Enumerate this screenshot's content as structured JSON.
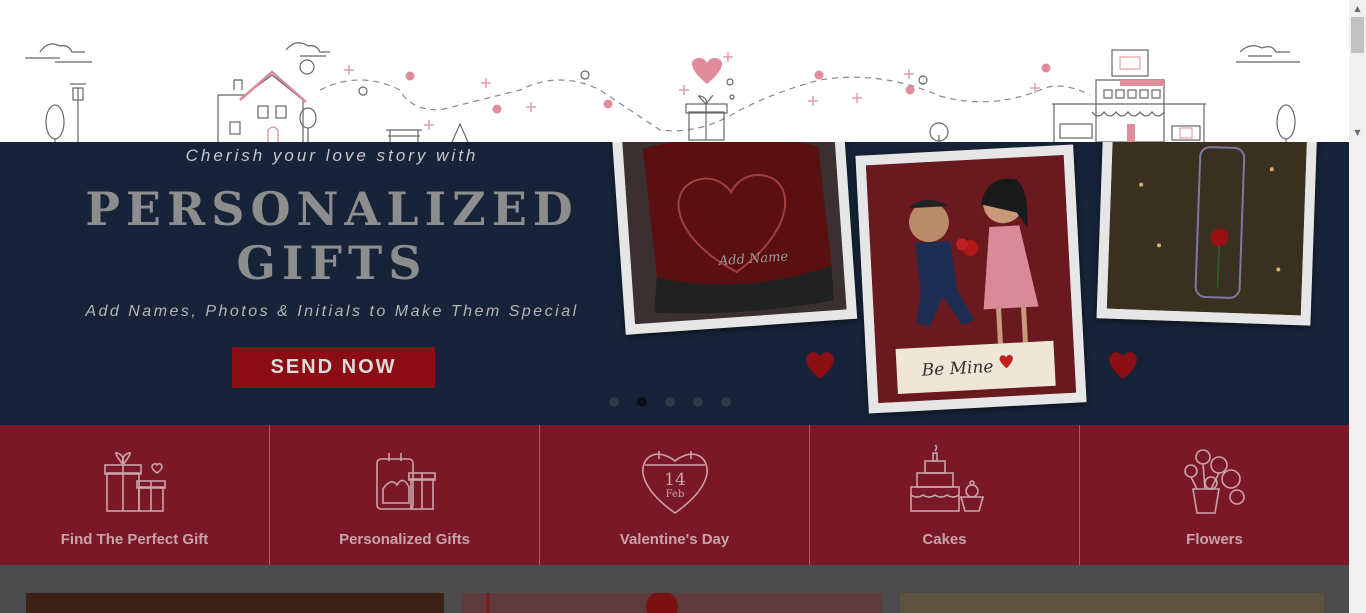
{
  "hero": {
    "tagline": "Cherish your love story with",
    "title_line1": "PERSONALIZED",
    "title_line2": "GIFTS",
    "subtitle": "Add Names, Photos & Initials to Make Them Special",
    "cta": "SEND NOW",
    "slides": 5,
    "active_slide": 2,
    "photo1_caption": "Add Name",
    "photo2_caption": "Be Mine"
  },
  "categories": [
    {
      "label": "Find The Perfect Gift",
      "icon": "gift-boxes-icon"
    },
    {
      "label": "Personalized Gifts",
      "icon": "personalized-gift-icon"
    },
    {
      "label": "Valentine's Day",
      "icon": "heart-calendar-icon",
      "day": "14",
      "month": "Feb"
    },
    {
      "label": "Cakes",
      "icon": "cake-icon"
    },
    {
      "label": "Flowers",
      "icon": "flower-bouquet-icon"
    }
  ],
  "colors": {
    "hero_bg": "#162338",
    "category_bg": "#7a1828",
    "cta_bg": "#8b0c12",
    "accent_pink": "#e8a0ac"
  }
}
